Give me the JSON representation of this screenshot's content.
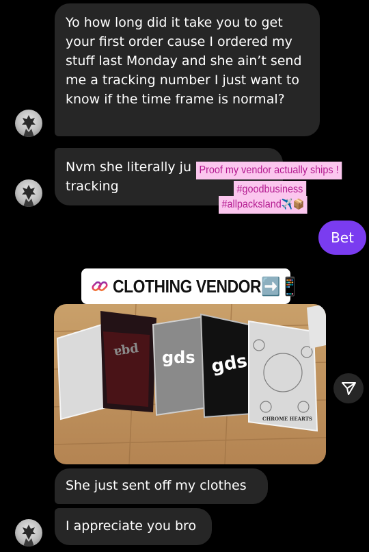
{
  "conversation": {
    "messages": [
      {
        "text": "Yo how long did it take you to get your first order cause I ordered my stuff last Monday and she ain’t send me a tracking number  I just want to know if the time frame is normal?"
      },
      {
        "text": "Nvm she literally ju"
      },
      {
        "text": "tracking"
      },
      {
        "text": "Bet"
      },
      {
        "text": "She just sent off my clothes"
      },
      {
        "text": "I appreciate you bro"
      }
    ],
    "sent_reply": "Bet"
  },
  "stickers": {
    "line1": "Proof my vendor actually ships !",
    "line2": "#goodbusiness",
    "line3": "#allpacksland",
    "line3_emoji": "✈️📦"
  },
  "shared_post": {
    "vendor_label": "CLOTHING VENDOR",
    "vendor_emoji": "➡️📱",
    "photo_text": {
      "bag_label_1": "gds",
      "bag_label_2": "gds",
      "bag_label_3": "CHROME HEARTS"
    }
  },
  "icons": {
    "avatar": "avatar-icon",
    "link": "link-icon",
    "share": "send-icon"
  },
  "colors": {
    "background": "#000000",
    "bubble": "#262626",
    "sent_bubble": "#7a3cf0",
    "sticker_bg": "#fbc6ee",
    "sticker_text": "#b3198f"
  }
}
